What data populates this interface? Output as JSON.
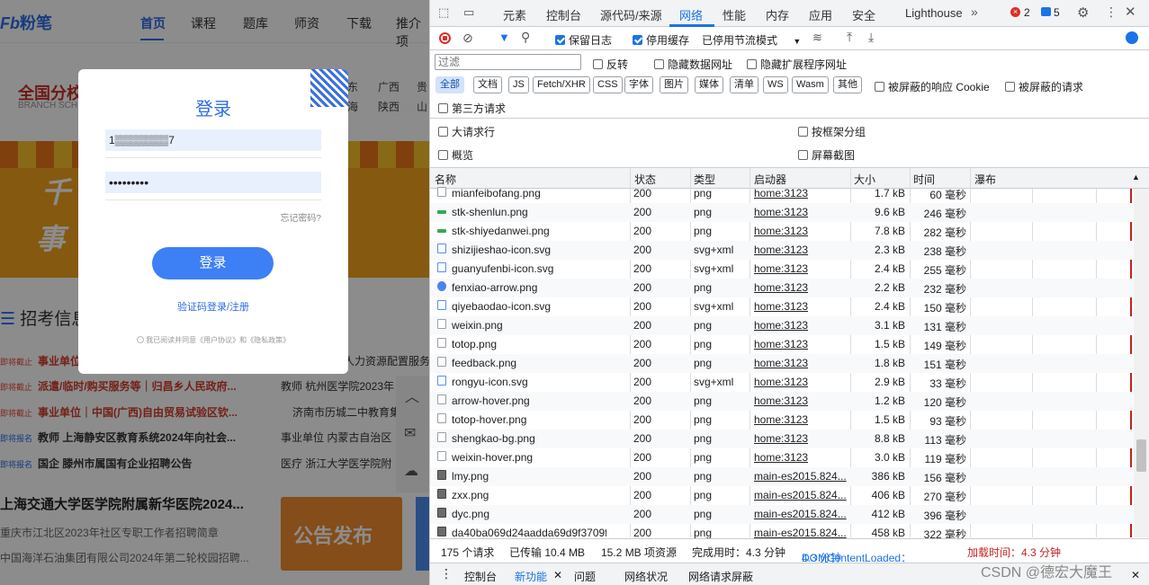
{
  "site": {
    "logo": "粉笔",
    "nav": [
      "首页",
      "课程",
      "题库",
      "师资",
      "下载",
      "推介项"
    ],
    "brand": "全国分校",
    "brand_sub": "BRANCH SCH",
    "regions": [
      "东",
      "广西",
      "贵",
      "海",
      "陕西",
      "山"
    ],
    "section_title": "招考信息",
    "banner_text1": "千",
    "banner_text2": "事",
    "news": [
      {
        "tag": "即将截止",
        "text": "事业单位"
      },
      {
        "tag": "即将截止",
        "text": "派遣/临时/购买服务等｜归昌乡人民政府..."
      },
      {
        "tag": "即将截止",
        "text": "事业单位｜中国(广西)自由贸易试验区钦..."
      },
      {
        "tag": "即将报名",
        "text": "教师  上海静安区教育系统2024年向社会..."
      },
      {
        "tag": "即将报名",
        "text": "国企  滕州市属国有企业招聘公告"
      }
    ],
    "right_news": [
      "人力资源配置服务",
      "教师  杭州医学院2023年",
      "济南市历城二中教育集团",
      "事业单位  内蒙古自治区",
      "医疗  浙江大学医学院附"
    ],
    "headline": "上海交通大学医学院附属新华医院2024...",
    "sub1": "重庆市江北区2023年社区专职工作者招聘简章",
    "sub2": "中国海洋石油集团有限公司2024年第二轮校园招聘...",
    "notice": "公告发布"
  },
  "login": {
    "title": "登录",
    "phone": "1▒▒▒▒▒▒▒7",
    "password": "•••••••••",
    "forgot": "忘记密码?",
    "button": "登录",
    "alt": "验证码登录/注册",
    "agree": "我已阅读并同意《用户协议》和《隐私政策》"
  },
  "devtools": {
    "tabs": [
      "元素",
      "控制台",
      "源代码/来源",
      "网络",
      "性能",
      "内存",
      "应用",
      "安全",
      "Lighthouse"
    ],
    "errors": "2",
    "messages": "5",
    "toolbar": {
      "preserve_log": "保留日志",
      "disable_cache": "停用缓存",
      "throttle": "已停用节流模式"
    },
    "filter_placeholder": "过滤",
    "invert": "反转",
    "hide_data": "隐藏数据网址",
    "hide_ext": "隐藏扩展程序网址",
    "types": [
      "全部",
      "文档",
      "JS",
      "Fetch/XHR",
      "CSS",
      "字体",
      "图片",
      "媒体",
      "清单",
      "WS",
      "Wasm",
      "其他"
    ],
    "blocked_cookie": "被屏蔽的响应 Cookie",
    "blocked_req": "被屏蔽的请求",
    "third_party": "第三方请求",
    "big_rows": "大请求行",
    "group_frame": "按框架分组",
    "overview": "概览",
    "screenshots": "屏幕截图",
    "headers": [
      "名称",
      "状态",
      "类型",
      "启动器",
      "大小",
      "时间",
      "瀑布"
    ],
    "rows": [
      {
        "n": "mianfeibofang.png",
        "s": "200",
        "t": "png",
        "i": "home:3123",
        "z": "1.7 kB",
        "m": "60 毫秒",
        "ic": "plain"
      },
      {
        "n": "stk-shenlun.png",
        "s": "200",
        "t": "png",
        "i": "home:3123",
        "z": "9.6 kB",
        "m": "246 毫秒",
        "ic": "green"
      },
      {
        "n": "stk-shiyedanwei.png",
        "s": "200",
        "t": "png",
        "i": "home:3123",
        "z": "7.8 kB",
        "m": "282 毫秒",
        "ic": "green"
      },
      {
        "n": "shizijieshao-icon.svg",
        "s": "200",
        "t": "svg+xml",
        "i": "home:3123",
        "z": "2.3 kB",
        "m": "238 毫秒",
        "ic": "svg"
      },
      {
        "n": "guanyufenbi-icon.svg",
        "s": "200",
        "t": "svg+xml",
        "i": "home:3123",
        "z": "2.4 kB",
        "m": "255 毫秒",
        "ic": "svg"
      },
      {
        "n": "fenxiao-arrow.png",
        "s": "200",
        "t": "png",
        "i": "home:3123",
        "z": "2.2 kB",
        "m": "232 毫秒",
        "ic": "blue"
      },
      {
        "n": "qiyebaodao-icon.svg",
        "s": "200",
        "t": "svg+xml",
        "i": "home:3123",
        "z": "2.4 kB",
        "m": "150 毫秒",
        "ic": "svg"
      },
      {
        "n": "weixin.png",
        "s": "200",
        "t": "png",
        "i": "home:3123",
        "z": "3.1 kB",
        "m": "131 毫秒",
        "ic": "plain"
      },
      {
        "n": "totop.png",
        "s": "200",
        "t": "png",
        "i": "home:3123",
        "z": "1.5 kB",
        "m": "149 毫秒",
        "ic": "plain"
      },
      {
        "n": "feedback.png",
        "s": "200",
        "t": "png",
        "i": "home:3123",
        "z": "1.8 kB",
        "m": "151 毫秒",
        "ic": "plain"
      },
      {
        "n": "rongyu-icon.svg",
        "s": "200",
        "t": "svg+xml",
        "i": "home:3123",
        "z": "2.9 kB",
        "m": "33 毫秒",
        "ic": "svg"
      },
      {
        "n": "arrow-hover.png",
        "s": "200",
        "t": "png",
        "i": "home:3123",
        "z": "1.2 kB",
        "m": "120 毫秒",
        "ic": "plain"
      },
      {
        "n": "totop-hover.png",
        "s": "200",
        "t": "png",
        "i": "home:3123",
        "z": "1.5 kB",
        "m": "93 毫秒",
        "ic": "plain"
      },
      {
        "n": "shengkao-bg.png",
        "s": "200",
        "t": "png",
        "i": "home:3123",
        "z": "8.8 kB",
        "m": "113 毫秒",
        "ic": "plain"
      },
      {
        "n": "weixin-hover.png",
        "s": "200",
        "t": "png",
        "i": "home:3123",
        "z": "3.0 kB",
        "m": "119 毫秒",
        "ic": "plain"
      },
      {
        "n": "lmy.png",
        "s": "200",
        "t": "png",
        "i": "main-es2015.824...",
        "z": "386 kB",
        "m": "156 毫秒",
        "ic": "img"
      },
      {
        "n": "zxx.png",
        "s": "200",
        "t": "png",
        "i": "main-es2015.824...",
        "z": "406 kB",
        "m": "270 毫秒",
        "ic": "img"
      },
      {
        "n": "dyc.png",
        "s": "200",
        "t": "png",
        "i": "main-es2015.824...",
        "z": "412 kB",
        "m": "396 毫秒",
        "ic": "img"
      },
      {
        "n": "da40ba069d24aadda69d9f3709fa9...",
        "s": "200",
        "t": "png",
        "i": "main-es2015.824...",
        "z": "458 kB",
        "m": "322 毫秒",
        "ic": "img"
      }
    ],
    "status": {
      "requests": "175 个请求",
      "transferred": "已传输 10.4 MB",
      "resources": "15.2 MB 项资源",
      "finish": "完成用时：4.3 分钟",
      "dcl_label": "DOMContentLoaded：",
      "dcl": "4.3 分钟",
      "load": "加载时间：4.3 分钟"
    },
    "drawer": [
      "控制台",
      "新功能",
      "问题",
      "网络状况",
      "网络请求屏蔽"
    ],
    "watermark": "CSDN @德宏大魔王"
  }
}
